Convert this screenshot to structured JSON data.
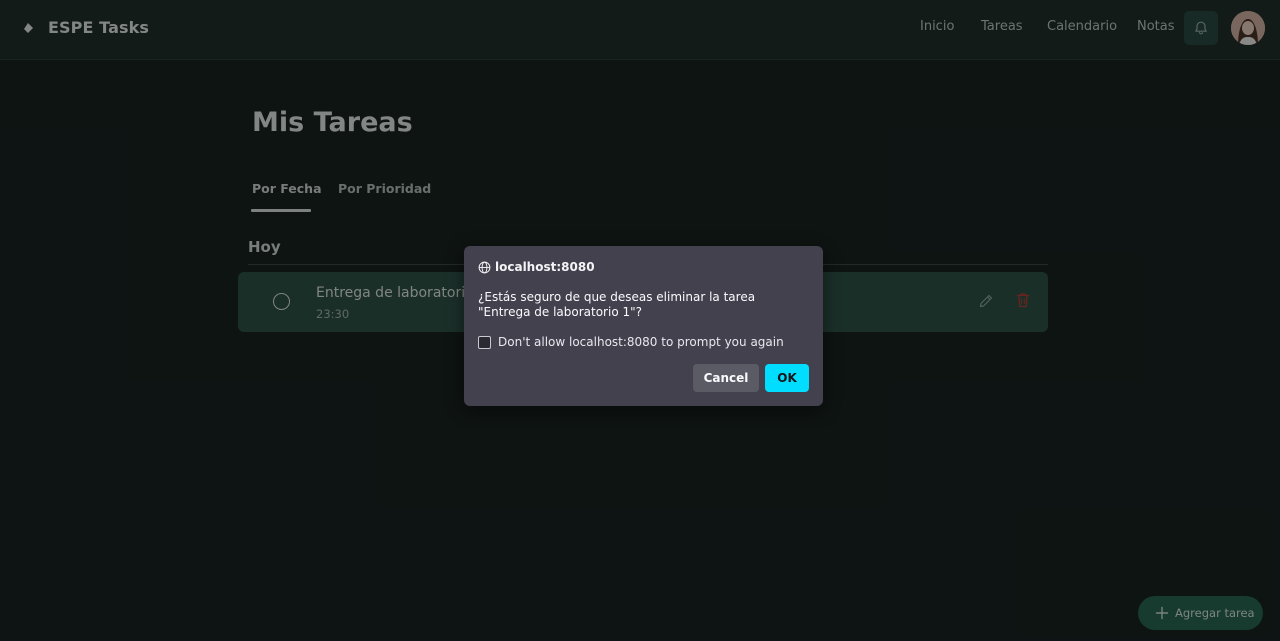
{
  "app": {
    "brand": "ESPE Tasks"
  },
  "nav": {
    "items": [
      "Inicio",
      "Tareas",
      "Calendario",
      "Notas"
    ]
  },
  "header": {
    "bell_icon": "bell-icon",
    "avatar": "user-avatar"
  },
  "main": {
    "title": "Mis Tareas",
    "tabs": [
      "Por Fecha",
      "Por Prioridad"
    ],
    "active_tab": "Por Fecha",
    "section": "Hoy",
    "tasks": [
      {
        "title": "Entrega de laboratorio 1",
        "time": "23:30",
        "completed": false
      }
    ]
  },
  "fab": {
    "label": "Agregar tarea",
    "icon": "plus-icon"
  },
  "dialog": {
    "origin": "localhost:8080",
    "message": "¿Estás seguro de que deseas eliminar la tarea \"Entrega de laboratorio 1\"?",
    "checkbox_label": "Don't allow localhost:8080 to prompt you again",
    "checkbox_checked": false,
    "cancel_label": "Cancel",
    "ok_label": "OK"
  },
  "colors": {
    "background": "#141c1b",
    "topbar": "#1d2826",
    "task_card": "#2c4d44",
    "fab": "#25634e",
    "dialog": "#42414d",
    "ok_button": "#00ddff",
    "delete_icon": "#c0392b"
  }
}
